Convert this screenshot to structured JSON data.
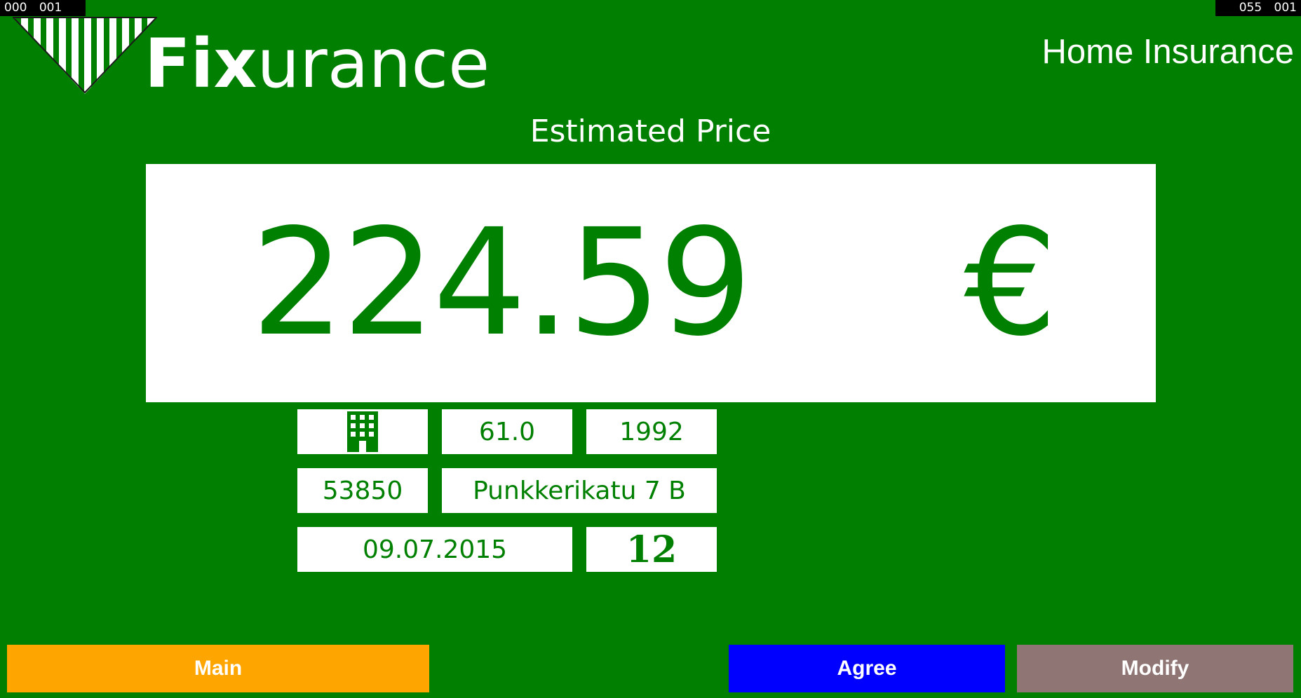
{
  "debug": {
    "left": "000 001",
    "right": "055 001"
  },
  "brand": {
    "name_bold": "Fix",
    "name_rest": "urance"
  },
  "header": {
    "title": "Home Insurance"
  },
  "estimate": {
    "label": "Estimated Price",
    "amount": "224.59",
    "currency": "€"
  },
  "details": {
    "property_type_icon": "apartment-building-icon",
    "area": "61.0",
    "year_built": "1992",
    "postal_code": "53850",
    "address": "Punkkerikatu 7 B",
    "start_date": "09.07.2015",
    "months": "12"
  },
  "buttons": {
    "main": "Main",
    "agree": "Agree",
    "modify": "Modify"
  },
  "colors": {
    "background": "#007f00",
    "text_green": "#008000",
    "main_button": "#ffa500",
    "agree_button": "#0000ff",
    "modify_button": "#8f7674"
  }
}
